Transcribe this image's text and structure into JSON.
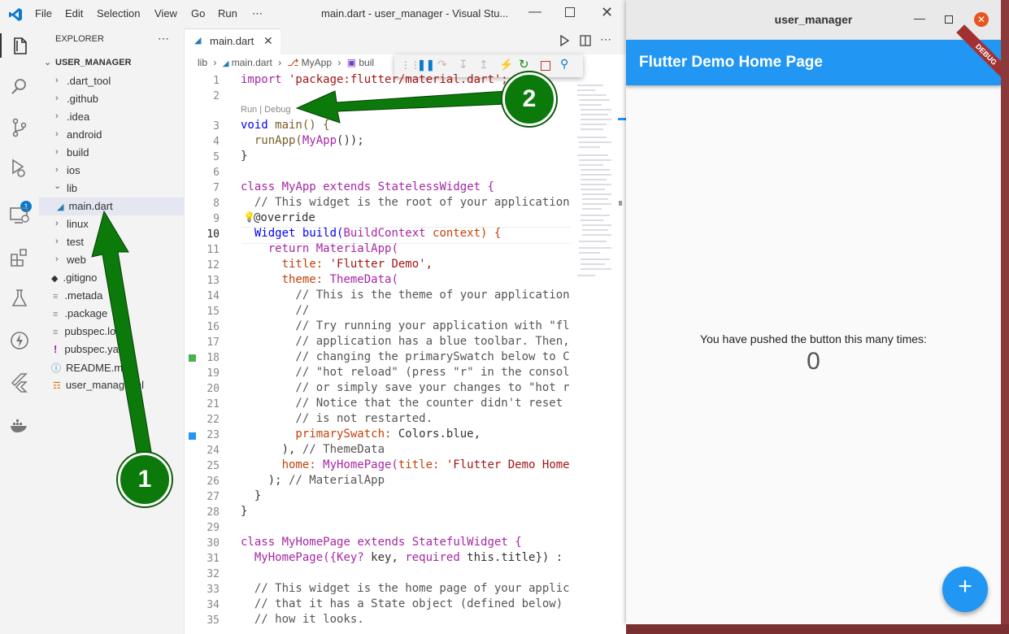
{
  "vscode": {
    "window_title": "main.dart - user_manager - Visual Stu...",
    "menu": [
      "File",
      "Edit",
      "Selection",
      "View",
      "Go",
      "Run",
      "⋯"
    ],
    "explorer_title": "EXPLORER",
    "explorer_more": "⋯",
    "project": "USER_MANAGER",
    "tree": [
      {
        "label": ".dart_tool",
        "kind": "folder"
      },
      {
        "label": ".github",
        "kind": "folder"
      },
      {
        "label": ".idea",
        "kind": "folder"
      },
      {
        "label": "android",
        "kind": "folder"
      },
      {
        "label": "build",
        "kind": "folder"
      },
      {
        "label": "ios",
        "kind": "folder"
      },
      {
        "label": "lib",
        "kind": "folder-open"
      },
      {
        "label": "main.dart",
        "kind": "dart-file"
      },
      {
        "label": "linux",
        "kind": "folder"
      },
      {
        "label": "test",
        "kind": "folder"
      },
      {
        "label": "web",
        "kind": "folder"
      },
      {
        "label": ".gitigno",
        "kind": "git-file"
      },
      {
        "label": ".metada",
        "kind": "file"
      },
      {
        "label": ".package",
        "kind": "file"
      },
      {
        "label": "pubspec.l",
        "kind": "file"
      },
      {
        "label": "pubspec.y",
        "kind": "yaml-file"
      },
      {
        "label": "README.m",
        "kind": "info-file"
      },
      {
        "label": "user_manag",
        "kind": "rss-file"
      }
    ],
    "tree_suffixes": {
      "pubspec_lock": "ock",
      "pubspec_yaml": "aml",
      "iml": "t.iml"
    },
    "debug_badge": "1",
    "tab_label": "main.dart",
    "breadcrumb": [
      "lib",
      "main.dart",
      "MyApp",
      "buil"
    ],
    "codelens": "Run | Debug",
    "line_numbers": [
      "1",
      "2",
      "3",
      "4",
      "5",
      "6",
      "7",
      "8",
      "9",
      "10",
      "11",
      "12",
      "13",
      "14",
      "15",
      "16",
      "17",
      "18",
      "19",
      "20",
      "21",
      "22",
      "23",
      "24",
      "25",
      "26",
      "27",
      "28",
      "29",
      "30",
      "31",
      "32",
      "33",
      "34",
      "35"
    ],
    "code": {
      "l1": [
        "import",
        " 'package:flutter/material.dart';"
      ],
      "l3": [
        "void",
        " main() {"
      ],
      "l4": [
        "  runApp(",
        "MyApp",
        "());"
      ],
      "l5": [
        "}"
      ],
      "l7": [
        "class",
        " MyApp ",
        "extends",
        " StatelessWidget {"
      ],
      "l8": [
        "  // This widget is the root of your application"
      ],
      "l9": [
        "@override"
      ],
      "l10": [
        "  Widget build(",
        "BuildContext",
        " context) {"
      ],
      "l11": [
        "    return",
        " MaterialApp("
      ],
      "l12": [
        "      title:",
        " 'Flutter Demo',"
      ],
      "l13": [
        "      theme:",
        " ThemeData("
      ],
      "l14": [
        "        // This is the theme of your application"
      ],
      "l15": [
        "        //"
      ],
      "l16": [
        "        // Try running your application with \"fl"
      ],
      "l17": [
        "        // application has a blue toolbar. Then,"
      ],
      "l18": [
        "        // changing the primarySwatch below to C"
      ],
      "l19": [
        "        // \"hot reload\" (press \"r\" in the consol"
      ],
      "l20": [
        "        // or simply save your changes to \"hot r"
      ],
      "l21": [
        "        // Notice that the counter didn't reset"
      ],
      "l22": [
        "        // is not restarted."
      ],
      "l23": [
        "        primarySwatch:",
        " Colors.blue,"
      ],
      "l24": [
        "      ),",
        " // ThemeData"
      ],
      "l25": [
        "      home:",
        " MyHomePage(",
        "title:",
        " 'Flutter Demo Home"
      ],
      "l26": [
        "    );",
        " // MaterialApp"
      ],
      "l27": [
        "  }"
      ],
      "l28": [
        "}"
      ],
      "l30": [
        "class",
        " MyHomePage ",
        "extends",
        " StatefulWidget {"
      ],
      "l31": [
        "  MyHomePage({",
        "Key?",
        " key, ",
        "required",
        " this.title}) :"
      ],
      "l33": [
        "  // This widget is the home page of your applic"
      ],
      "l34": [
        "  // that it has a State object (defined below)"
      ],
      "l35": [
        "  // how it looks."
      ]
    }
  },
  "flutter": {
    "window_title": "user_manager",
    "appbar_title": "Flutter Demo Home Page",
    "debug_banner": "DEBUG",
    "counter_label": "You have pushed the button this many times:",
    "counter_value": "0",
    "fab_label": "+"
  },
  "annotations": {
    "badge1": "1",
    "badge2": "2"
  },
  "colors": {
    "accent": "#2196f3",
    "annotation": "#0b7a0b"
  }
}
